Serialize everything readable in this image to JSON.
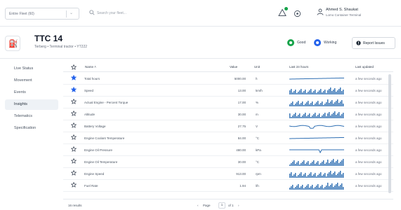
{
  "topbar": {
    "fleet": "Entire Fleet (60)",
    "search_placeholder": "Search your fleet...",
    "user_name": "Ahmed S. Shaukat",
    "user_org": "Lomo Container Terminal"
  },
  "asset": {
    "title": "TTC 14",
    "subtitle": "Terberg • Terminal tractor • YT222",
    "status_good": "Good",
    "status_working": "Working",
    "report_button": "Report Issues"
  },
  "sidebar": {
    "items": [
      {
        "label": "Live Status",
        "active": false
      },
      {
        "label": "Movement",
        "active": false
      },
      {
        "label": "Events",
        "active": false
      },
      {
        "label": "Insights",
        "active": true
      },
      {
        "label": "Telematics",
        "active": false
      },
      {
        "label": "Specification",
        "active": false
      }
    ]
  },
  "table": {
    "headers": {
      "name": "Name ˄",
      "value": "Value",
      "unit": "Unit",
      "last24": "Last 24 hours",
      "updated": "Last updated"
    },
    "rows": [
      {
        "name": "Total hours",
        "value": "5000.00",
        "unit": "h",
        "updated": "a few seconds ago",
        "starred": true,
        "spark": "line"
      },
      {
        "name": "Speed",
        "value": "13.00",
        "unit": "km/h",
        "updated": "a few seconds ago",
        "starred": true,
        "spark": "bars"
      },
      {
        "name": "Actual Engine - Percent Torque",
        "value": "17.00",
        "unit": "%",
        "updated": "a few seconds ago",
        "starred": false,
        "spark": "bars"
      },
      {
        "name": "Altitude",
        "value": "30.00",
        "unit": "m",
        "updated": "a few seconds ago",
        "starred": false,
        "spark": "bars"
      },
      {
        "name": "Battery Voltage",
        "value": "27.75",
        "unit": "V",
        "updated": "a few seconds ago",
        "starred": false,
        "spark": "wave"
      },
      {
        "name": "Engine Coolant Temperature",
        "value": "84.00",
        "unit": "°C",
        "updated": "a few seconds ago",
        "starred": false,
        "spark": "line"
      },
      {
        "name": "Engine Oil Pressure",
        "value": "480.00",
        "unit": "kPa",
        "updated": "a few seconds ago",
        "starred": false,
        "spark": "dip"
      },
      {
        "name": "Engine Oil Temperature",
        "value": "30.00",
        "unit": "°C",
        "updated": "a few seconds ago",
        "starred": false,
        "spark": "bars"
      },
      {
        "name": "Engine Speed",
        "value": "913.00",
        "unit": "rpm",
        "updated": "a few seconds ago",
        "starred": false,
        "spark": "bars"
      },
      {
        "name": "Fuel Rate",
        "value": "1.94",
        "unit": "l/h",
        "updated": "a few seconds ago",
        "starred": false,
        "spark": "bars"
      }
    ]
  },
  "footer": {
    "count": "16 results",
    "page_label": "Page",
    "page": "1",
    "of_label": "of 1"
  },
  "colors": {
    "accent": "#2563eb",
    "good": "#16a34a",
    "spark": "#2f6fb3"
  }
}
